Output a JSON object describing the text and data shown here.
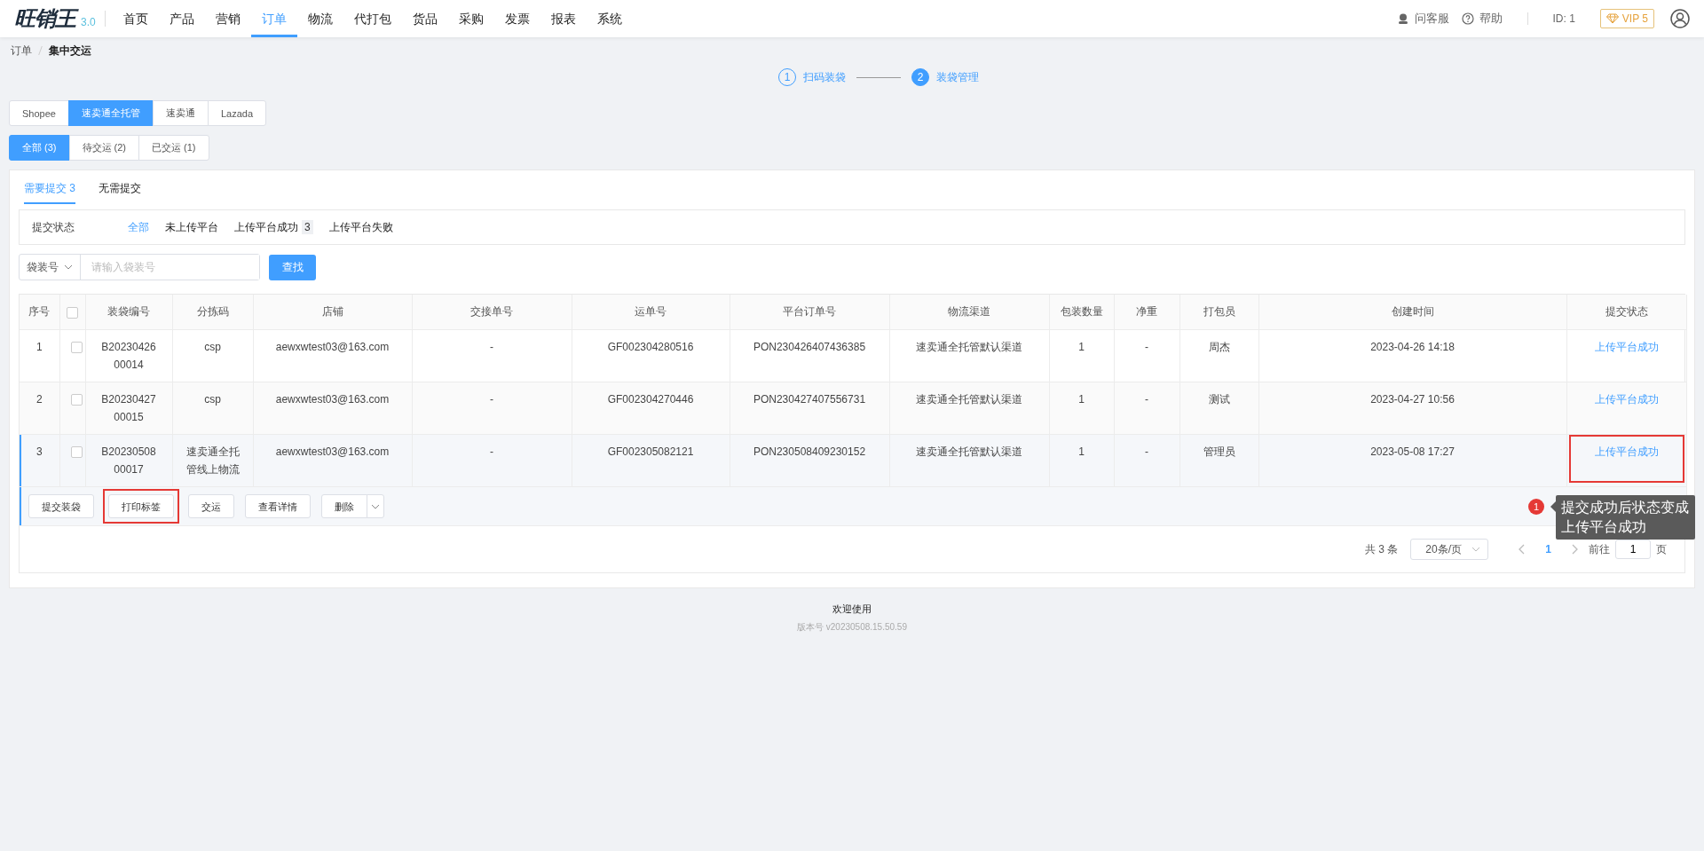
{
  "nav": {
    "logo": "旺销王",
    "version": "3.0",
    "items": [
      {
        "label": "首页",
        "selected": false
      },
      {
        "label": "产品",
        "selected": false
      },
      {
        "label": "营销",
        "selected": false
      },
      {
        "label": "订单",
        "selected": true
      },
      {
        "label": "物流",
        "selected": false
      },
      {
        "label": "代打包",
        "selected": false
      },
      {
        "label": "货品",
        "selected": false
      },
      {
        "label": "采购",
        "selected": false
      },
      {
        "label": "发票",
        "selected": false
      },
      {
        "label": "报表",
        "selected": false
      },
      {
        "label": "系统",
        "selected": false
      }
    ],
    "service": "问客服",
    "help": "帮助",
    "user_id": "ID: 1",
    "vip": "VIP 5"
  },
  "breadcrumb": [
    "订单",
    "集中交运"
  ],
  "steps": [
    {
      "number": "1",
      "label": "扫码装袋",
      "selected": false
    },
    {
      "number": "2",
      "label": "装袋管理",
      "selected": true
    }
  ],
  "platform_tabs": [
    {
      "label": "Shopee",
      "selected": false
    },
    {
      "label": "速卖通全托管",
      "selected": true
    },
    {
      "label": "速卖通",
      "selected": false
    },
    {
      "label": "Lazada",
      "selected": false
    }
  ],
  "status_tabs": [
    {
      "label": "全部 (3)",
      "selected": true
    },
    {
      "label": "待交运 (2)",
      "selected": false
    },
    {
      "label": "已交运 (1)",
      "selected": false
    }
  ],
  "sub_tabs": [
    {
      "label": "需要提交 3",
      "selected": true
    },
    {
      "label": "无需提交",
      "selected": false
    }
  ],
  "filter": {
    "label": "提交状态",
    "options": [
      {
        "label": "全部",
        "selected": true
      },
      {
        "label": "未上传平台",
        "selected": false
      },
      {
        "label": "上传平台成功",
        "count": "3",
        "selected": false
      },
      {
        "label": "上传平台失败",
        "selected": false
      }
    ]
  },
  "search": {
    "field_type": "袋装号",
    "placeholder": "请输入袋装号",
    "button": "查找"
  },
  "table": {
    "select_all_checked": false,
    "columns": [
      "序号",
      "",
      "装袋编号",
      "分拣码",
      "店铺",
      "交接单号",
      "运单号",
      "平台订单号",
      "物流渠道",
      "包装数量",
      "净重",
      "打包员",
      "创建时间",
      "提交状态"
    ],
    "rows": [
      {
        "checked": false,
        "selected": false,
        "status_highlighted": false,
        "cells": [
          "1",
          "",
          "B2023042600014",
          "csp",
          "aewxwtest03@163.com",
          "-",
          "GF002304280516",
          "PON230426407436385",
          "速卖通全托管默认渠道",
          "1",
          "-",
          "周杰",
          "2023-04-26 14:18",
          "上传平台成功"
        ]
      },
      {
        "checked": false,
        "selected": false,
        "status_highlighted": false,
        "cells": [
          "2",
          "",
          "B2023042700015",
          "csp",
          "aewxwtest03@163.com",
          "-",
          "GF002304270446",
          "PON230427407556731",
          "速卖通全托管默认渠道",
          "1",
          "-",
          "测试",
          "2023-04-27 10:56",
          "上传平台成功"
        ]
      },
      {
        "checked": false,
        "selected": true,
        "status_highlighted": true,
        "cells": [
          "3",
          "",
          "B2023050800017",
          "速卖通全托管线上物流",
          "aewxwtest03@163.com",
          "-",
          "GF002305082121",
          "PON230508409230152",
          "速卖通全托管默认渠道",
          "1",
          "-",
          "管理员",
          "2023-05-08 17:27",
          "上传平台成功"
        ]
      }
    ]
  },
  "row_actions": [
    {
      "label": "提交装袋",
      "highlighted": false,
      "has_menu": false
    },
    {
      "label": "打印标签",
      "highlighted": true,
      "has_menu": false
    },
    {
      "label": "交运",
      "highlighted": false,
      "has_menu": false
    },
    {
      "label": "查看详情",
      "highlighted": false,
      "has_menu": false
    },
    {
      "label": "删除",
      "highlighted": false,
      "has_menu": true
    }
  ],
  "pagination": {
    "total": "共 3 条",
    "page_size": "20条/页",
    "pages": [
      {
        "label": "1",
        "selected": true
      }
    ],
    "goto_label": "前往",
    "goto_value": "1",
    "page_suffix": "页"
  },
  "annotation": {
    "number": "1",
    "text": "提交成功后状态变成上传平台成功"
  },
  "footer": {
    "welcome": "欢迎使用",
    "version": "版本号 v20230508.15.50.59"
  }
}
